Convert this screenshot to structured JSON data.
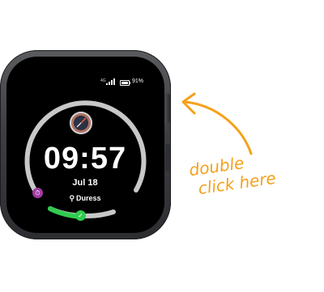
{
  "watch": {
    "status": {
      "network": "4G",
      "battery_percent": "91%"
    },
    "face": {
      "time": "09:57",
      "date": "Jul 18",
      "complication_label": "Duress"
    },
    "icons": {
      "compass": "compass-icon",
      "timer": "timer-icon",
      "check": "check-icon",
      "location": "location-pin-icon"
    },
    "colors": {
      "ring_track": "#c8c8c8",
      "ring_progress": "#2fcc4e",
      "timer_badge": "#a03aa3"
    }
  },
  "annotation": {
    "line1": "double",
    "line2": "click here",
    "color": "#f5a11a"
  }
}
